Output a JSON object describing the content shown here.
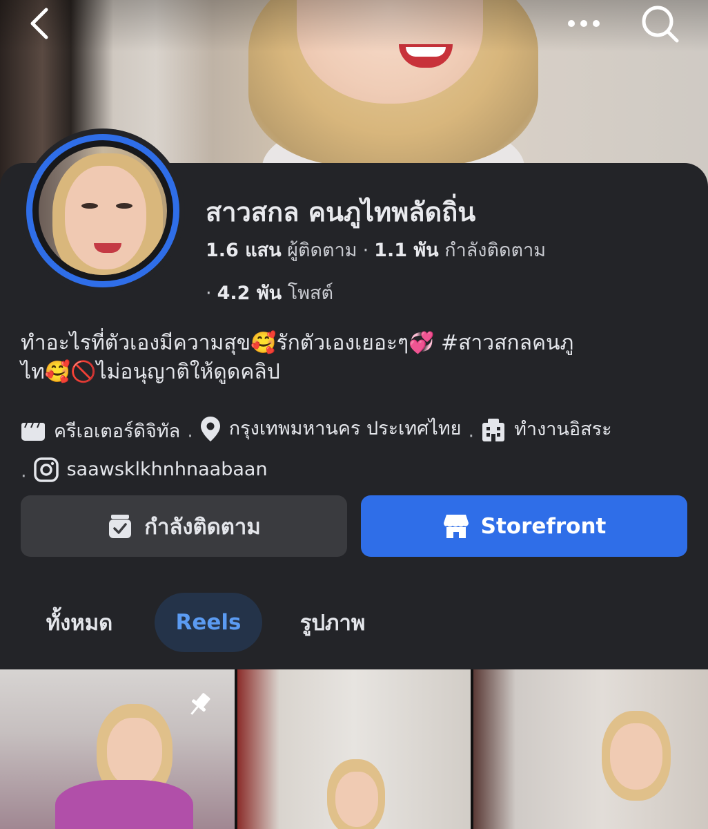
{
  "header": {
    "back_icon": "chevron-left-icon",
    "more_icon": "more-dots-icon",
    "search_icon": "search-icon"
  },
  "profile": {
    "name": "สาวสกล คนภูไทพลัดถิ่น",
    "followers_count": "1.6 แสน",
    "followers_label": "ผู้ติดตาม",
    "following_count": "1.1 พัน",
    "following_label": "กำลังติดตาม",
    "posts_count": "4.2 พัน",
    "posts_label": "โพสต์",
    "bio_line1": "ทำอะไรที่ตัวเองมีความสุข🥰รักตัวเองเยอะๆ💞 #สาวสกลคนภู",
    "bio_line2": "ไท🥰🚫ไม่อนุญาติให้ดูดคลิป",
    "ring_color": "#2f6ee8"
  },
  "details": {
    "category": "ครีเอเตอร์ดิจิทัล",
    "location": "กรุงเทพมหานคร ประเทศไทย",
    "work": "ทำงานอิสระ",
    "instagram": "saawsklkhnhnaabaan"
  },
  "actions": {
    "following_label": "กำลังติดตาม",
    "storefront_label": "Storefront",
    "accent": "#2f6ee8"
  },
  "tabs": [
    {
      "label": "ทั้งหมด",
      "selected": false
    },
    {
      "label": "Reels",
      "selected": true
    },
    {
      "label": "รูปภาพ",
      "selected": false
    }
  ],
  "reels": [
    {
      "pinned": true
    },
    {
      "pinned": false
    },
    {
      "pinned": false
    }
  ]
}
